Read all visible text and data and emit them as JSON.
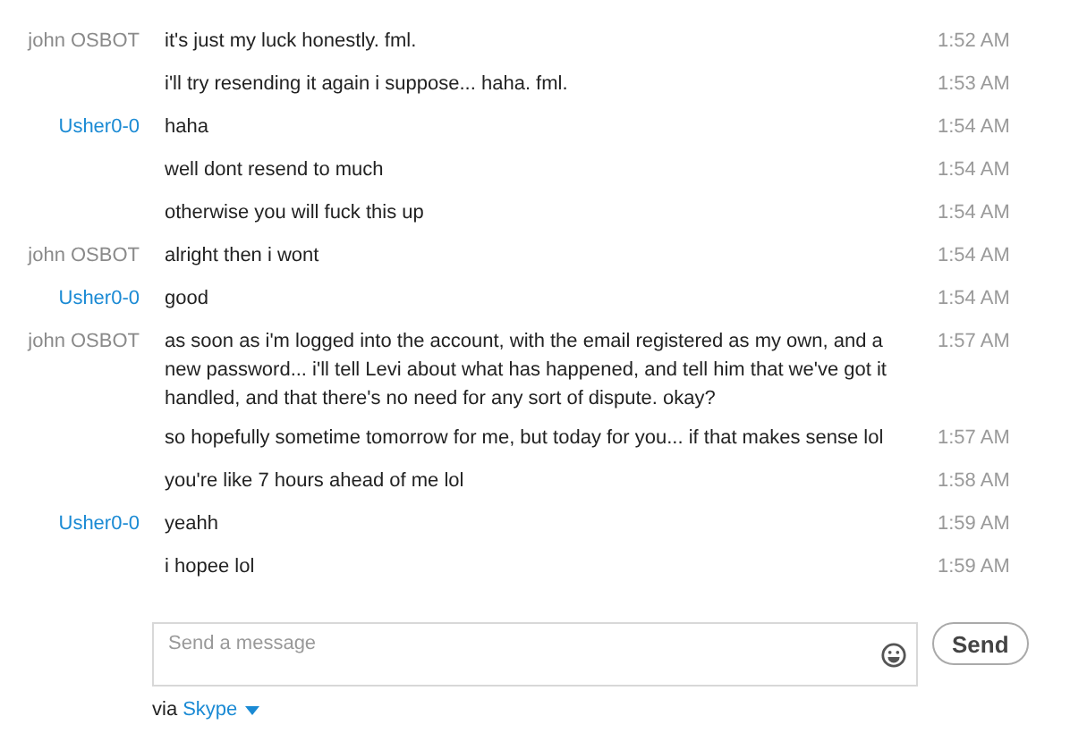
{
  "messages": [
    {
      "sender": "john OSBOT",
      "color": "#8a8a8a",
      "text": "it's just my luck honestly. fml.",
      "time": "1:52 AM"
    },
    {
      "text": "i'll try resending it again i suppose... haha. fml.",
      "time": "1:53 AM"
    },
    {
      "sender": "Usher0-0",
      "color": "#1a8ad4",
      "text": "haha",
      "time": "1:54 AM"
    },
    {
      "text": "well dont resend to much",
      "time": "1:54 AM"
    },
    {
      "text": "otherwise you will fuck this up",
      "time": "1:54 AM"
    },
    {
      "sender": "john OSBOT",
      "color": "#8a8a8a",
      "text": "alright then i wont",
      "time": "1:54 AM"
    },
    {
      "sender": "Usher0-0",
      "color": "#1a8ad4",
      "text": "good",
      "time": "1:54 AM"
    },
    {
      "sender": "john OSBOT",
      "color": "#8a8a8a",
      "text": "as soon as i'm logged into the account, with the email registered as my own, and a new password... i'll tell Levi about what has happened, and tell him that we've got it handled, and that there's no need for any sort of dispute. okay?",
      "time": "1:57 AM"
    },
    {
      "text": "so hopefully sometime tomorrow for me, but today for you... if that makes sense lol",
      "time": "1:57 AM"
    },
    {
      "text": "you're like 7 hours ahead of me lol",
      "time": "1:58 AM"
    },
    {
      "sender": "Usher0-0",
      "color": "#1a8ad4",
      "text": "yeahh",
      "time": "1:59 AM"
    },
    {
      "text": "i hopee lol",
      "time": "1:59 AM"
    }
  ],
  "composer": {
    "placeholder": "Send a message",
    "send": "Send"
  },
  "footer": {
    "via": "via",
    "service": "Skype"
  }
}
